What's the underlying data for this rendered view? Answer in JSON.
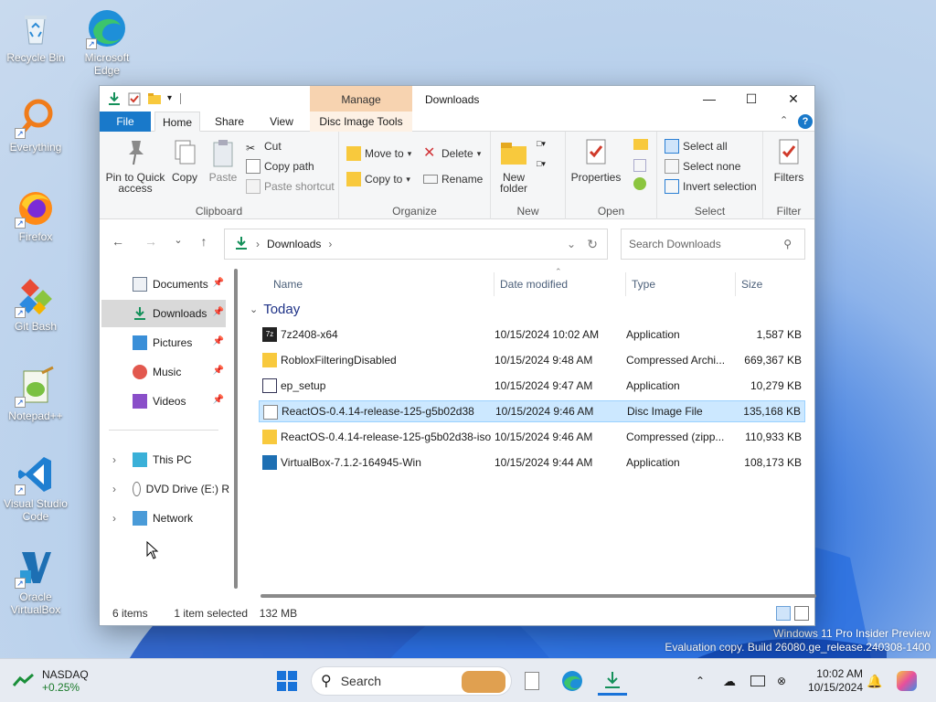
{
  "desktop": {
    "icons": [
      {
        "label": "Recycle Bin"
      },
      {
        "label": "Microsoft Edge"
      },
      {
        "label": "Everything"
      },
      {
        "label": "Firefox"
      },
      {
        "label": "Git Bash"
      },
      {
        "label": "Notepad++"
      },
      {
        "label": "Visual Studio Code"
      },
      {
        "label": "Oracle VirtualBox"
      }
    ],
    "watermark": {
      "line1": "Windows 11 Pro Insider Preview",
      "line2": "Evaluation copy. Build 26080.ge_release.240308-1400"
    }
  },
  "window": {
    "title": "Downloads",
    "contextual_tab_group": "Manage",
    "tabs": {
      "file": "File",
      "home": "Home",
      "share": "Share",
      "view": "View",
      "disc": "Disc Image Tools"
    },
    "ribbon": {
      "clipboard": {
        "label": "Clipboard",
        "pin": "Pin to Quick access",
        "copy": "Copy",
        "paste": "Paste",
        "cut": "Cut",
        "copy_path": "Copy path",
        "paste_shortcut": "Paste shortcut"
      },
      "organize": {
        "label": "Organize",
        "move_to": "Move to",
        "copy_to": "Copy to",
        "delete": "Delete",
        "rename": "Rename"
      },
      "new": {
        "label": "New",
        "new_folder": "New folder"
      },
      "open": {
        "label": "Open",
        "properties": "Properties"
      },
      "select": {
        "label": "Select",
        "select_all": "Select all",
        "select_none": "Select none",
        "invert": "Invert selection"
      },
      "filter": {
        "label": "Filter",
        "filters": "Filters"
      }
    },
    "address": {
      "crumb": "Downloads"
    },
    "search": {
      "placeholder": "Search Downloads"
    },
    "nav": {
      "items": [
        {
          "label": "Documents"
        },
        {
          "label": "Downloads"
        },
        {
          "label": "Pictures"
        },
        {
          "label": "Music"
        },
        {
          "label": "Videos"
        },
        {
          "label": "This PC"
        },
        {
          "label": "DVD Drive (E:) R"
        },
        {
          "label": "Network"
        }
      ]
    },
    "columns": {
      "name": "Name",
      "date": "Date modified",
      "type": "Type",
      "size": "Size"
    },
    "group": "Today",
    "files": [
      {
        "name": "7z2408-x64",
        "date": "10/15/2024 10:02 AM",
        "type": "Application",
        "size": "1,587 KB"
      },
      {
        "name": "RobloxFilteringDisabled",
        "date": "10/15/2024 9:48 AM",
        "type": "Compressed Archi...",
        "size": "669,367 KB"
      },
      {
        "name": "ep_setup",
        "date": "10/15/2024 9:47 AM",
        "type": "Application",
        "size": "10,279 KB"
      },
      {
        "name": "ReactOS-0.4.14-release-125-g5b02d38",
        "date": "10/15/2024 9:46 AM",
        "type": "Disc Image File",
        "size": "135,168 KB"
      },
      {
        "name": "ReactOS-0.4.14-release-125-g5b02d38-iso",
        "date": "10/15/2024 9:46 AM",
        "type": "Compressed (zipp...",
        "size": "110,933 KB"
      },
      {
        "name": "VirtualBox-7.1.2-164945-Win",
        "date": "10/15/2024 9:44 AM",
        "type": "Application",
        "size": "108,173 KB"
      }
    ],
    "status": {
      "count": "6 items",
      "selection": "1 item selected",
      "size": "132 MB"
    }
  },
  "taskbar": {
    "stock": {
      "name": "NASDAQ",
      "change": "+0.25%"
    },
    "search_label": "Search",
    "time": "10:02 AM",
    "date": "10/15/2024"
  }
}
